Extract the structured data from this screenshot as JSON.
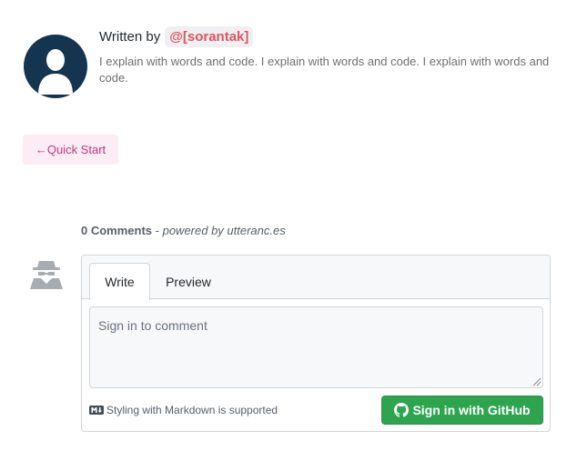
{
  "author": {
    "prefix": "Written by",
    "handle": "@[sorantak]",
    "bio": "I explain with words and code. I explain with words and code. I explain with words and code."
  },
  "nav": {
    "back_label": "←Quick Start"
  },
  "comments": {
    "count_label": "0 Comments",
    "separator": " - ",
    "powered_by": "powered by utteranc.es",
    "tabs": [
      {
        "label": "Write",
        "active": true
      },
      {
        "label": "Preview",
        "active": false
      }
    ],
    "placeholder": "Sign in to comment",
    "markdown_note": "Styling with Markdown is supported",
    "signin_label": "Sign in with GitHub"
  },
  "colors": {
    "avatar_bg": "#14344f",
    "handle": "#e0535e",
    "back_button_bg": "#fcedf5",
    "back_button_text": "#c3357f",
    "signin_button": "#2ea44f"
  },
  "icons": {
    "author_avatar": "user-silhouette-icon",
    "anonymous_avatar": "anonymous-user-icon",
    "markdown": "markdown-icon",
    "github": "github-icon"
  }
}
